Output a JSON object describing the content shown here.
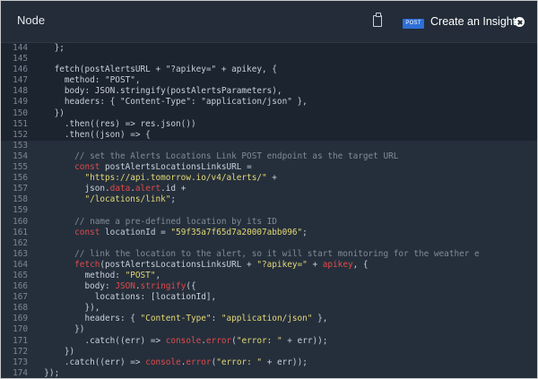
{
  "header": {
    "tab_title": "Node",
    "badge": "POST",
    "create_insight": "Create an Insight",
    "clipboard_icon": "clipboard-icon",
    "close_icon": "close-circle-icon"
  },
  "code_lines": [
    {
      "n": "144",
      "hl": false,
      "t": [
        [
          "t",
          "    };"
        ]
      ]
    },
    {
      "n": "145",
      "hl": false,
      "t": []
    },
    {
      "n": "146",
      "hl": false,
      "t": [
        [
          "t",
          "    fetch(postAlertsURL + \"?apikey=\" + apikey, {"
        ]
      ]
    },
    {
      "n": "147",
      "hl": false,
      "t": [
        [
          "t",
          "      method: \"POST\","
        ]
      ]
    },
    {
      "n": "148",
      "hl": false,
      "t": [
        [
          "t",
          "      body: JSON.stringify(postAlertsParameters),"
        ]
      ]
    },
    {
      "n": "149",
      "hl": false,
      "t": [
        [
          "t",
          "      headers: { \"Content-Type\": \"application/json\" },"
        ]
      ]
    },
    {
      "n": "150",
      "hl": false,
      "t": [
        [
          "t",
          "    })"
        ]
      ]
    },
    {
      "n": "151",
      "hl": false,
      "t": [
        [
          "t",
          "      .then((res) => res.json())"
        ]
      ]
    },
    {
      "n": "152",
      "hl": false,
      "t": [
        [
          "t",
          "      .then((json) => {"
        ]
      ]
    },
    {
      "n": "153",
      "hl": true,
      "t": []
    },
    {
      "n": "154",
      "hl": true,
      "t": [
        [
          "c",
          "        // set the Alerts Locations Link POST endpoint as the target URL"
        ]
      ]
    },
    {
      "n": "155",
      "hl": true,
      "t": [
        [
          "k",
          "        const "
        ],
        [
          "t",
          "postAlertsLocationsLinksURL ="
        ]
      ]
    },
    {
      "n": "156",
      "hl": true,
      "t": [
        [
          "s",
          "          \"https://api.tomorrow.io/v4/alerts/\""
        ],
        [
          "t",
          " +"
        ]
      ]
    },
    {
      "n": "157",
      "hl": true,
      "t": [
        [
          "t",
          "          json."
        ],
        [
          "k",
          "data"
        ],
        [
          "t",
          "."
        ],
        [
          "k",
          "alert"
        ],
        [
          "t",
          ".id +"
        ]
      ]
    },
    {
      "n": "158",
      "hl": true,
      "t": [
        [
          "s",
          "          \"/locations/link\""
        ],
        [
          "t",
          ";"
        ]
      ]
    },
    {
      "n": "159",
      "hl": true,
      "t": []
    },
    {
      "n": "160",
      "hl": true,
      "t": [
        [
          "c",
          "        // name a pre-defined location by its ID"
        ]
      ]
    },
    {
      "n": "161",
      "hl": true,
      "t": [
        [
          "k",
          "        const "
        ],
        [
          "t",
          "locationId = "
        ],
        [
          "s",
          "\"59f35a7f65d7a20007abb096\""
        ],
        [
          "t",
          ";"
        ]
      ]
    },
    {
      "n": "162",
      "hl": true,
      "t": []
    },
    {
      "n": "163",
      "hl": true,
      "t": [
        [
          "c",
          "        // link the location to the alert, so it will start monitoring for the weather e"
        ]
      ]
    },
    {
      "n": "164",
      "hl": true,
      "t": [
        [
          "f",
          "        fetch"
        ],
        [
          "t",
          "(postAlertsLocationsLinksURL + "
        ],
        [
          "s",
          "\"?apikey=\""
        ],
        [
          "t",
          " + "
        ],
        [
          "k",
          "apikey"
        ],
        [
          "t",
          ", {"
        ]
      ]
    },
    {
      "n": "165",
      "hl": true,
      "t": [
        [
          "t",
          "          method: "
        ],
        [
          "s",
          "\"POST\""
        ],
        [
          "t",
          ","
        ]
      ]
    },
    {
      "n": "166",
      "hl": true,
      "t": [
        [
          "t",
          "          body: "
        ],
        [
          "k",
          "JSON"
        ],
        [
          "t",
          "."
        ],
        [
          "k",
          "stringify"
        ],
        [
          "t",
          "({"
        ]
      ]
    },
    {
      "n": "167",
      "hl": true,
      "t": [
        [
          "t",
          "            locations: [locationId],"
        ]
      ]
    },
    {
      "n": "168",
      "hl": true,
      "t": [
        [
          "t",
          "          }),"
        ]
      ]
    },
    {
      "n": "169",
      "hl": true,
      "t": [
        [
          "t",
          "          headers: { "
        ],
        [
          "s",
          "\"Content-Type\""
        ],
        [
          "t",
          ": "
        ],
        [
          "s",
          "\"application/json\""
        ],
        [
          "t",
          " },"
        ]
      ]
    },
    {
      "n": "170",
      "hl": true,
      "t": [
        [
          "t",
          "        })"
        ]
      ]
    },
    {
      "n": "171",
      "hl": true,
      "t": [
        [
          "t",
          "          .catch((err) => "
        ],
        [
          "k",
          "console"
        ],
        [
          "t",
          "."
        ],
        [
          "k",
          "error"
        ],
        [
          "t",
          "("
        ],
        [
          "s",
          "\"error: \""
        ],
        [
          "t",
          " + err));"
        ]
      ]
    },
    {
      "n": "172",
      "hl": true,
      "t": [
        [
          "t",
          "      })"
        ]
      ]
    },
    {
      "n": "173",
      "hl": true,
      "t": [
        [
          "t",
          "      .catch((err) => "
        ],
        [
          "k",
          "console"
        ],
        [
          "t",
          "."
        ],
        [
          "k",
          "error"
        ],
        [
          "t",
          "("
        ],
        [
          "s",
          "\"error: \""
        ],
        [
          "t",
          " + err));"
        ]
      ]
    },
    {
      "n": "174",
      "hl": true,
      "t": [
        [
          "t",
          "  });"
        ]
      ]
    }
  ]
}
